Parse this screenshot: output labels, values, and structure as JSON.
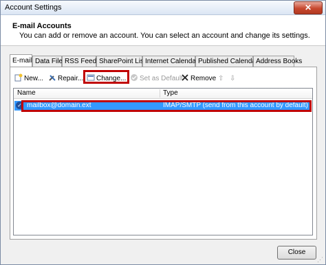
{
  "window": {
    "title": "Account Settings",
    "close_glyph": "✕"
  },
  "header": {
    "title": "E-mail Accounts",
    "subtitle": "You can add or remove an account. You can select an account and change its settings."
  },
  "tabs": [
    {
      "label": "E-mail",
      "active": true
    },
    {
      "label": "Data Files"
    },
    {
      "label": "RSS Feeds"
    },
    {
      "label": "SharePoint Lists"
    },
    {
      "label": "Internet Calendars"
    },
    {
      "label": "Published Calendars"
    },
    {
      "label": "Address Books"
    }
  ],
  "toolbar": {
    "new_label": "New...",
    "repair_label": "Repair...",
    "change_label": "Change...",
    "set_default_label": "Set as Default",
    "remove_label": "Remove",
    "up_glyph": "⇧",
    "down_glyph": "⇩"
  },
  "list": {
    "columns": {
      "name": "Name",
      "type": "Type"
    },
    "rows": [
      {
        "name": "mailbox@domain.ext",
        "type": "IMAP/SMTP (send from this account by default)",
        "selected": true
      }
    ]
  },
  "footer": {
    "close_label": "Close"
  },
  "colors": {
    "selection": "#3399ff",
    "highlight_box": "#c00000",
    "check": "#1f4e99"
  }
}
